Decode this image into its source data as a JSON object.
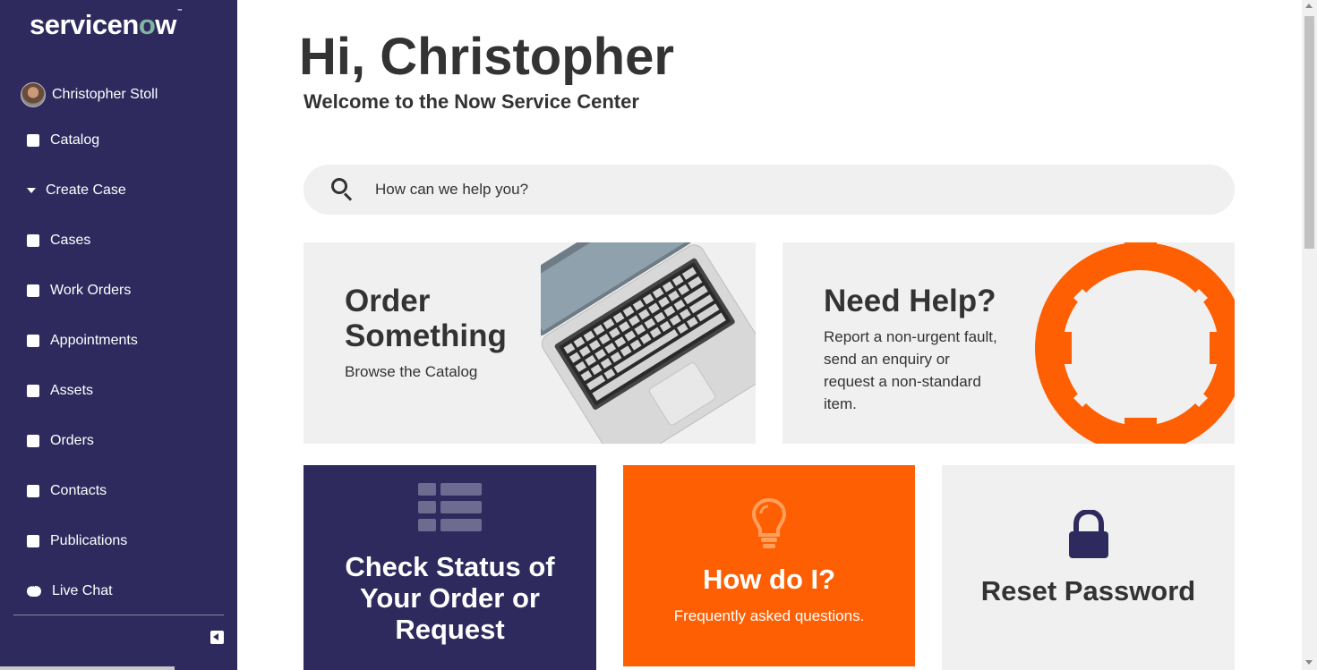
{
  "brand": {
    "logo_pre": "servicen",
    "logo_o": "o",
    "logo_post": "w",
    "logo_tm": "™"
  },
  "user": {
    "name": "Christopher Stoll"
  },
  "nav": {
    "items": [
      {
        "label": "Catalog",
        "icon": "checkbox-icon"
      },
      {
        "label": "Create Case",
        "icon": "caret-down-icon"
      },
      {
        "label": "Cases",
        "icon": "checkbox-icon"
      },
      {
        "label": "Work Orders",
        "icon": "checkbox-icon"
      },
      {
        "label": "Appointments",
        "icon": "checkbox-icon"
      },
      {
        "label": "Assets",
        "icon": "checkbox-icon"
      },
      {
        "label": "Orders",
        "icon": "checkbox-icon"
      },
      {
        "label": "Contacts",
        "icon": "checkbox-icon"
      },
      {
        "label": "Publications",
        "icon": "checkbox-icon"
      },
      {
        "label": "Live Chat",
        "icon": "chat-icon"
      }
    ]
  },
  "header": {
    "greeting": "Hi, Christopher",
    "welcome": "Welcome to the Now Service Center"
  },
  "search": {
    "placeholder": "How can we help you?"
  },
  "cards": {
    "order": {
      "title_line1": "Order",
      "title_line2": "Something",
      "subtitle": "Browse the Catalog"
    },
    "help": {
      "title": "Need Help?",
      "line1": "Report a non-urgent fault,",
      "line2": "send an enquiry or",
      "line3": "request a non-standard",
      "line4": "item."
    }
  },
  "tiles": {
    "status": {
      "line1": "Check Status of",
      "line2": "Your Order or",
      "line3": "Request"
    },
    "howdo": {
      "title": "How do I?",
      "subtitle": "Frequently asked questions."
    },
    "reset": {
      "title": "Reset Password"
    }
  },
  "colors": {
    "sidebar": "#2e2a5e",
    "accent_orange": "#ff5f03",
    "card_bg": "#f0f0f0",
    "logo_accent": "#81b5a1"
  }
}
